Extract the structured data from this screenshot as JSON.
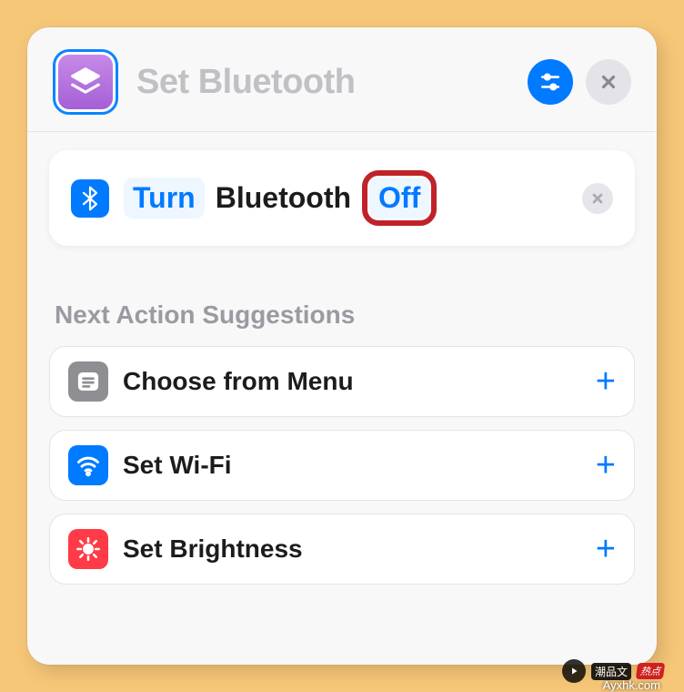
{
  "header": {
    "title": "Set Bluetooth"
  },
  "action": {
    "verb": "Turn",
    "subject": "Bluetooth",
    "state": "Off"
  },
  "suggestions_title": "Next Action Suggestions",
  "suggestions": [
    {
      "label": "Choose from Menu",
      "icon": "menu",
      "color": "gray"
    },
    {
      "label": "Set Wi-Fi",
      "icon": "wifi",
      "color": "blue"
    },
    {
      "label": "Set Brightness",
      "icon": "brightness",
      "color": "red"
    }
  ],
  "watermark": {
    "text1": "潮品文",
    "text2": "热点",
    "url": "Ayxhk.com"
  }
}
